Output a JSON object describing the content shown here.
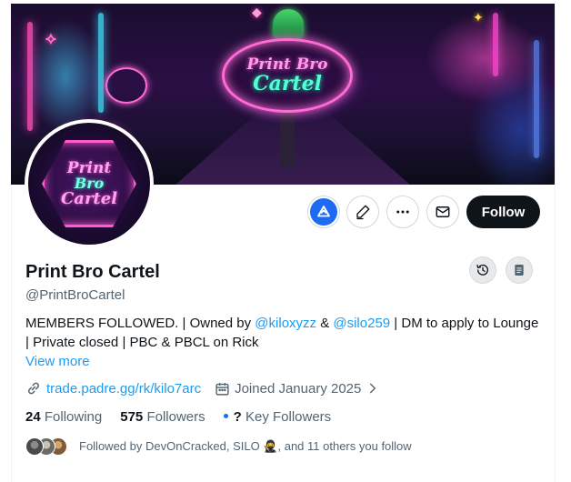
{
  "banner": {
    "sign_line1": "Print Bro",
    "sign_line2": "Cartel"
  },
  "avatar": {
    "line1": "Print",
    "line2": "Bro",
    "line3": "Cartel"
  },
  "actions": {
    "grok_icon": "grok-icon",
    "edit_icon": "pencil-icon",
    "more_icon": "more-dots-icon",
    "message_icon": "envelope-icon",
    "follow_label": "Follow"
  },
  "profile": {
    "display_name": "Print Bro Cartel",
    "handle": "@PrintBroCartel",
    "bio_part1": "MEMBERS FOLLOWED. | Owned by ",
    "bio_mention1": "@kiloxyzz",
    "bio_part2": " & ",
    "bio_mention2": "@silo259",
    "bio_part3": " | DM to apply to Lounge | Private closed | PBC & PBCL on Rick",
    "view_more": "View more",
    "website": "trade.padre.gg/rk/kilo7arc",
    "joined": "Joined January 2025",
    "following_count": "24",
    "following_label": "Following",
    "followers_count": "575",
    "followers_label": "Followers",
    "key_followers_count": "?",
    "key_followers_label": "Key Followers",
    "followed_by_text": "Followed by DevOnCracked, SILO 🥷, and 11 others you follow"
  },
  "colors": {
    "accent": "#1d9bf0",
    "follow_bg": "#0f1419",
    "grok_blue": "#1d6bf2"
  }
}
